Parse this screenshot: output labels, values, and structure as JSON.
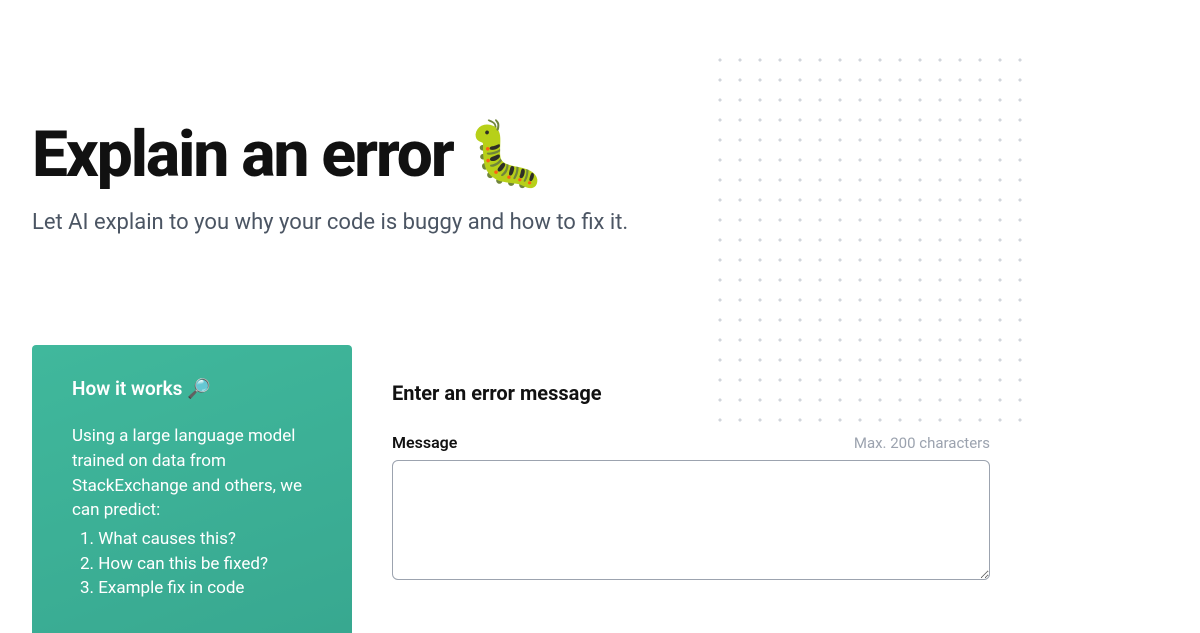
{
  "hero": {
    "title": "Explain an error 🐛",
    "subtitle": "Let AI explain to you why your code is buggy and how to fix it."
  },
  "sidebar": {
    "heading": "How it works 🔎",
    "intro": "Using a large language model trained on data from StackExchange and others, we can predict:",
    "items": [
      "What causes this?",
      "How can this be fixed?",
      "Example fix in code"
    ]
  },
  "form": {
    "title": "Enter an error message",
    "message_label": "Message",
    "max_hint": "Max. 200 characters",
    "message_value": ""
  }
}
